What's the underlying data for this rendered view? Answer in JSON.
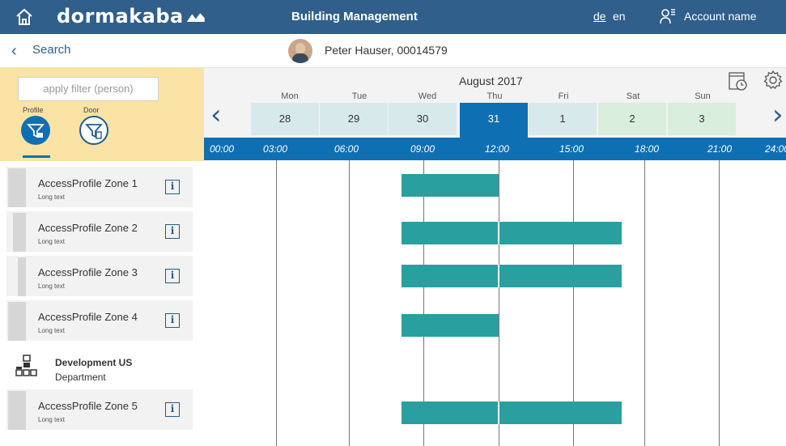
{
  "topbar": {
    "brand": "dormakaba",
    "title": "Building Management",
    "lang_de": "de",
    "lang_en": "en",
    "account": "Account name",
    "bg_color": "#2f5f8a"
  },
  "subbar": {
    "back_label": "Search",
    "person": "Peter Hauser, 00014579"
  },
  "filter": {
    "placeholder": "apply filter (person)",
    "profile_label": "Profile",
    "door_label": "Door"
  },
  "items": [
    {
      "name": "AccessProfile Zone 1",
      "sub": "Long text",
      "info": "i"
    },
    {
      "name": "AccessProfile Zone 2",
      "sub": "Long text",
      "info": "i"
    },
    {
      "name": "AccessProfile Zone 3",
      "sub": "Long text",
      "info": "i"
    },
    {
      "name": "AccessProfile Zone 4",
      "sub": "Long text",
      "info": "i"
    },
    {
      "name": "AccessProfile Zone 5",
      "sub": "Long text",
      "info": "i"
    }
  ],
  "department": {
    "name": "Development US",
    "sub": "Department"
  },
  "calendar": {
    "month": "August 2017",
    "days": [
      {
        "dow": "Mon",
        "num": "28"
      },
      {
        "dow": "Tue",
        "num": "29"
      },
      {
        "dow": "Wed",
        "num": "30"
      },
      {
        "dow": "Thu",
        "num": "31"
      },
      {
        "dow": "Fri",
        "num": "1"
      },
      {
        "dow": "Sat",
        "num": "2"
      },
      {
        "dow": "Sun",
        "num": "3"
      }
    ],
    "selected_day": "31",
    "times": [
      "00:00",
      "03:00",
      "06:00",
      "09:00",
      "12:00",
      "15:00",
      "18:00",
      "21:00",
      "24:00"
    ]
  },
  "colors": {
    "accent": "#0f6fb3",
    "event": "#2a9fa0",
    "filter_bg": "#fbe3a6"
  }
}
